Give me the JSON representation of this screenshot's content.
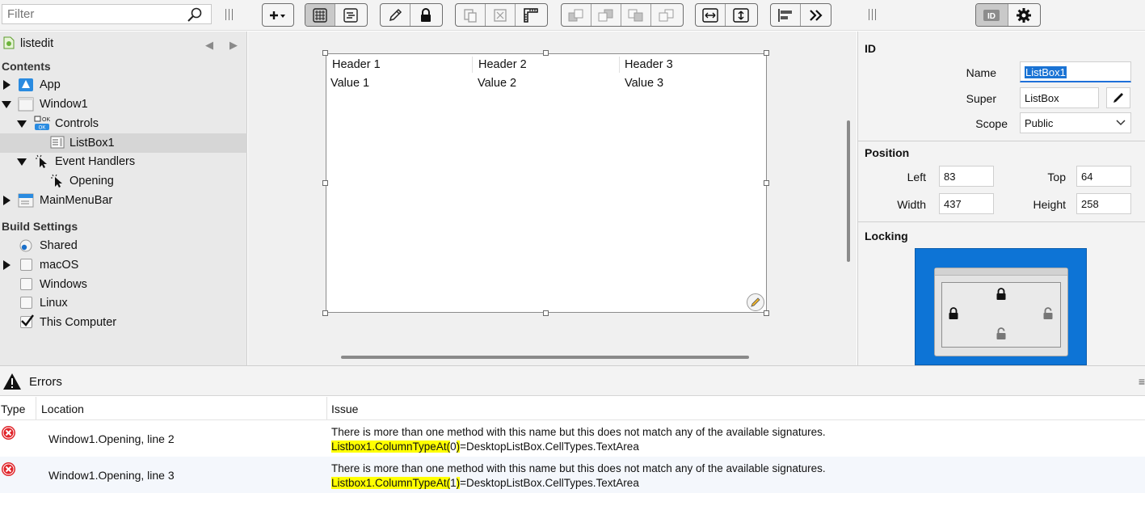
{
  "toolbar": {
    "filter_placeholder": "Filter"
  },
  "navigator": {
    "project_name": "listedit",
    "contents_header": "Contents",
    "items": [
      {
        "label": "App"
      },
      {
        "label": "Window1"
      },
      {
        "label": "Controls"
      },
      {
        "label": "ListBox1"
      },
      {
        "label": "Event Handlers"
      },
      {
        "label": "Opening"
      },
      {
        "label": "MainMenuBar"
      }
    ],
    "build_header": "Build Settings",
    "build_items": [
      {
        "label": "Shared",
        "state": "radio"
      },
      {
        "label": "macOS",
        "state": "unchecked"
      },
      {
        "label": "Windows",
        "state": "unchecked"
      },
      {
        "label": "Linux",
        "state": "unchecked"
      },
      {
        "label": "This Computer",
        "state": "checked"
      }
    ]
  },
  "listbox": {
    "headers": [
      "Header 1",
      "Header 2",
      "Header 3"
    ],
    "values": [
      "Value 1",
      "Value 2",
      "Value 3"
    ]
  },
  "inspector": {
    "id_header": "ID",
    "name_label": "Name",
    "name_value": "ListBox1",
    "super_label": "Super",
    "super_value": "ListBox",
    "scope_label": "Scope",
    "scope_value": "Public",
    "position_header": "Position",
    "left_label": "Left",
    "left_value": "83",
    "top_label": "Top",
    "top_value": "64",
    "width_label": "Width",
    "width_value": "437",
    "height_label": "Height",
    "height_value": "258",
    "locking_header": "Locking",
    "accent_color": "#0d74d6"
  },
  "errors": {
    "title": "Errors",
    "columns": [
      "Type",
      "Location",
      "Issue"
    ],
    "rows": [
      {
        "location": "Window1.Opening, line 2",
        "message": "There is more than one method with this name but this does not match any of the available signatures.",
        "code_highlight_a": "Listbox1.ColumnTypeAt(",
        "code_highlight_b": "0",
        "code_highlight_c": ")",
        "code_rest": "=DesktopListBox.CellTypes.TextArea"
      },
      {
        "location": "Window1.Opening, line 3",
        "message": "There is more than one method with this name but this does not match any of the available signatures.",
        "code_highlight_a": "Listbox1.ColumnTypeAt(",
        "code_highlight_b": "1",
        "code_highlight_c": ")",
        "code_rest": "=DesktopListBox.CellTypes.TextArea"
      }
    ]
  }
}
